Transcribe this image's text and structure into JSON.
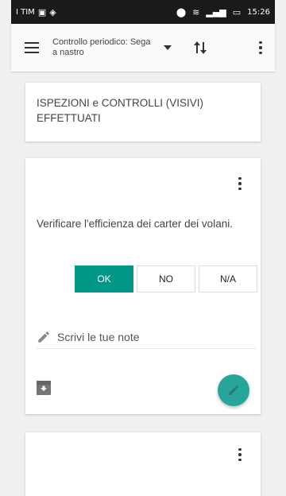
{
  "status_bar": {
    "carrier": "I TIM",
    "time": "15:26"
  },
  "toolbar": {
    "title": "Controllo periodico: Sega a nastro"
  },
  "section": {
    "title": "ISPEZIONI e CONTROLLI (VISIVI) EFFETTUATI"
  },
  "question": {
    "text": "Verificare l'efficienza dei carter dei volani.",
    "options": [
      {
        "label": "OK",
        "selected": true
      },
      {
        "label": "NO",
        "selected": false
      },
      {
        "label": "N/A",
        "selected": false
      }
    ],
    "note_placeholder": "Scrivi le tue note"
  },
  "colors": {
    "accent": "#009688",
    "fab": "#26a69a"
  }
}
